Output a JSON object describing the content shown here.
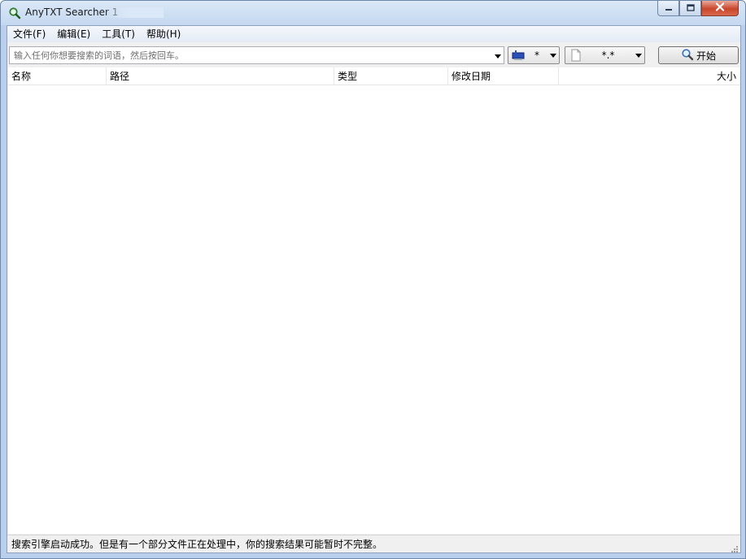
{
  "window": {
    "title": "AnyTXT Searcher 1"
  },
  "icons": {
    "app": "magnifier-icon",
    "minimize": "minimize-icon",
    "maximize": "maximize-icon",
    "close": "close-icon",
    "dropdown": "chevron-down-icon",
    "drive": "drive-icon",
    "file": "file-icon",
    "search": "search-icon"
  },
  "menu": [
    {
      "label": "文件(F)"
    },
    {
      "label": "编辑(E)"
    },
    {
      "label": "工具(T)"
    },
    {
      "label": "帮助(H)"
    }
  ],
  "search": {
    "value": "",
    "placeholder": "输入任何你想要搜索的词语，然后按回车。"
  },
  "drive_combo": {
    "value": "*"
  },
  "filter_combo": {
    "value": "*.*"
  },
  "start_button": {
    "label": "开始"
  },
  "columns": [
    {
      "label": "名称"
    },
    {
      "label": "路径"
    },
    {
      "label": "类型"
    },
    {
      "label": "修改日期"
    },
    {
      "label": "大小"
    }
  ],
  "rows": [],
  "status": {
    "text": "搜索引擎启动成功。但是有一个部分文件正在处理中，你的搜索结果可能暂时不完整。"
  },
  "colors": {
    "title_gradient_top": "#dbe8f7",
    "close_button": "#c9462c"
  }
}
